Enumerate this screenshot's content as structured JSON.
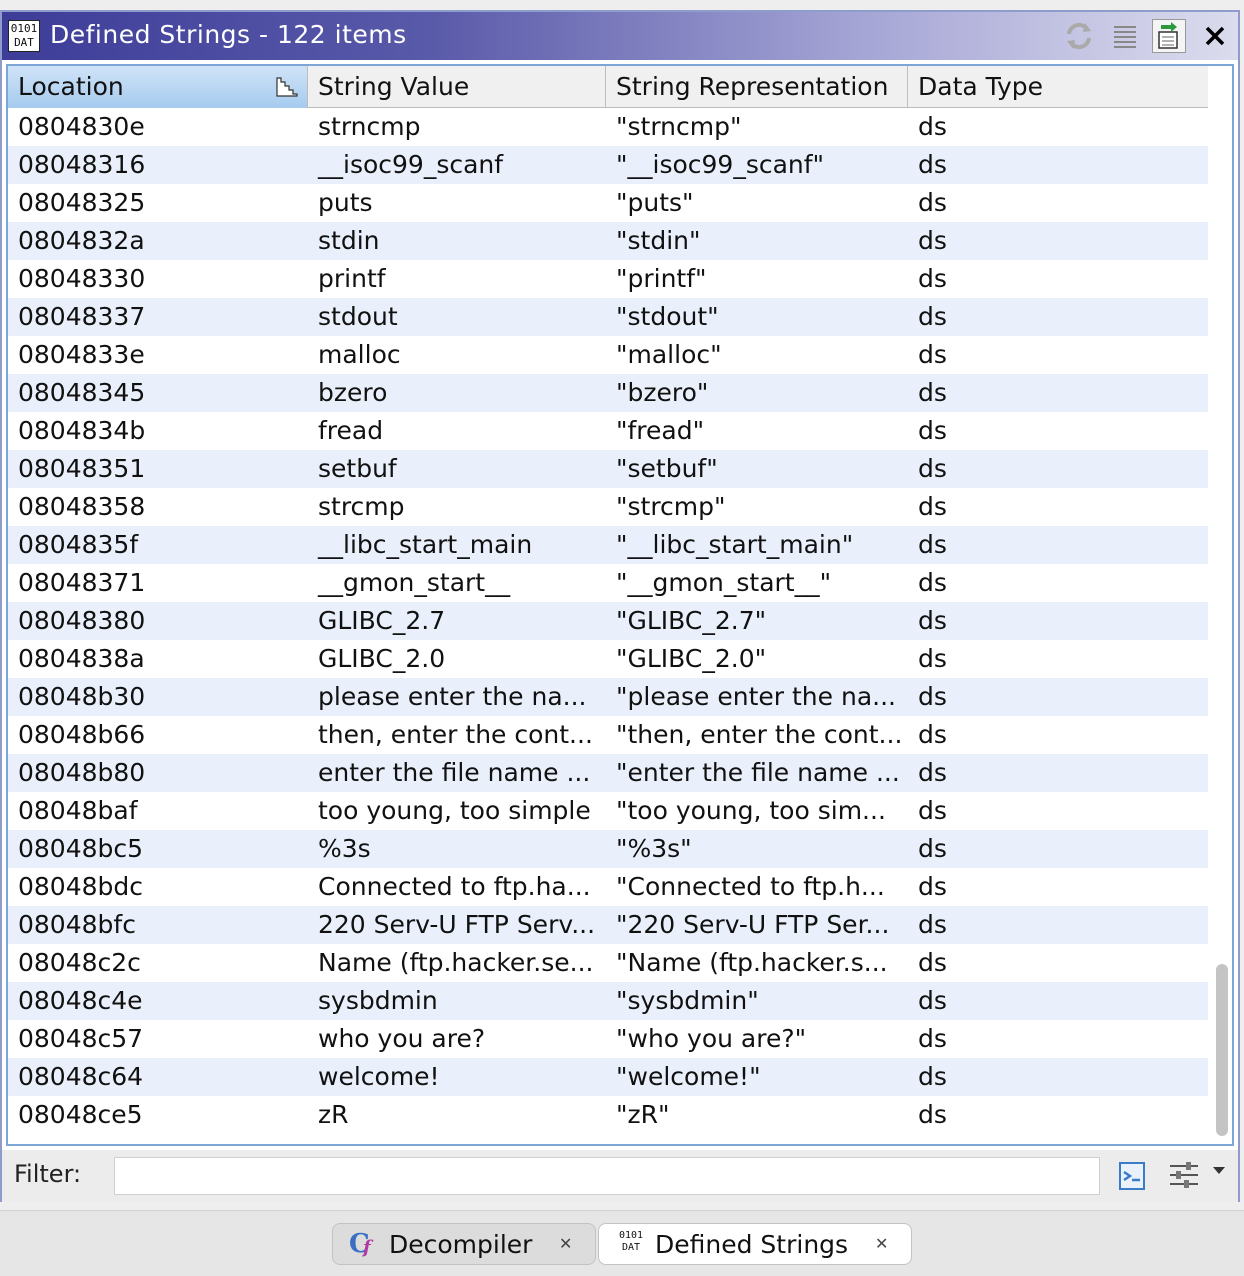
{
  "window": {
    "title": "Defined Strings - 122 items",
    "icon_text_line1": "0101",
    "icon_text_line2": "DAT",
    "toolbar_icons": [
      "refresh-icon",
      "list-icon",
      "navigate-icon",
      "close-icon"
    ]
  },
  "table": {
    "columns": [
      "Location",
      "String Value",
      "String Representation",
      "Data Type"
    ],
    "sorted_column": "Location",
    "rows": [
      {
        "location": "0804830e",
        "value": "strncmp",
        "repr": "\"strncmp\"",
        "type": "ds"
      },
      {
        "location": "08048316",
        "value": "__isoc99_scanf",
        "repr": "\"__isoc99_scanf\"",
        "type": "ds"
      },
      {
        "location": "08048325",
        "value": "puts",
        "repr": "\"puts\"",
        "type": "ds"
      },
      {
        "location": "0804832a",
        "value": "stdin",
        "repr": "\"stdin\"",
        "type": "ds"
      },
      {
        "location": "08048330",
        "value": "printf",
        "repr": "\"printf\"",
        "type": "ds"
      },
      {
        "location": "08048337",
        "value": "stdout",
        "repr": "\"stdout\"",
        "type": "ds"
      },
      {
        "location": "0804833e",
        "value": "malloc",
        "repr": "\"malloc\"",
        "type": "ds"
      },
      {
        "location": "08048345",
        "value": "bzero",
        "repr": "\"bzero\"",
        "type": "ds"
      },
      {
        "location": "0804834b",
        "value": "fread",
        "repr": "\"fread\"",
        "type": "ds"
      },
      {
        "location": "08048351",
        "value": "setbuf",
        "repr": "\"setbuf\"",
        "type": "ds"
      },
      {
        "location": "08048358",
        "value": "strcmp",
        "repr": "\"strcmp\"",
        "type": "ds"
      },
      {
        "location": "0804835f",
        "value": "__libc_start_main",
        "repr": "\"__libc_start_main\"",
        "type": "ds"
      },
      {
        "location": "08048371",
        "value": "__gmon_start__",
        "repr": "\"__gmon_start__\"",
        "type": "ds"
      },
      {
        "location": "08048380",
        "value": "GLIBC_2.7",
        "repr": "\"GLIBC_2.7\"",
        "type": "ds"
      },
      {
        "location": "0804838a",
        "value": "GLIBC_2.0",
        "repr": "\"GLIBC_2.0\"",
        "type": "ds"
      },
      {
        "location": "08048b30",
        "value": "please enter the na...",
        "repr": "\"please enter the na...",
        "type": "ds"
      },
      {
        "location": "08048b66",
        "value": "then, enter the cont...",
        "repr": "\"then, enter the cont...",
        "type": "ds"
      },
      {
        "location": "08048b80",
        "value": "enter the file name ...",
        "repr": "\"enter the file name ...",
        "type": "ds"
      },
      {
        "location": "08048baf",
        "value": "too young, too simple",
        "repr": "\"too young, too sim...",
        "type": "ds"
      },
      {
        "location": "08048bc5",
        "value": "%3s",
        "repr": "\"%3s\"",
        "type": "ds"
      },
      {
        "location": "08048bdc",
        "value": "Connected to ftp.ha...",
        "repr": "\"Connected to ftp.h...",
        "type": "ds"
      },
      {
        "location": "08048bfc",
        "value": "220 Serv-U FTP Serv...",
        "repr": "\"220 Serv-U FTP Ser...",
        "type": "ds"
      },
      {
        "location": "08048c2c",
        "value": "Name (ftp.hacker.se...",
        "repr": "\"Name (ftp.hacker.s...",
        "type": "ds"
      },
      {
        "location": "08048c4e",
        "value": "sysbdmin",
        "repr": "\"sysbdmin\"",
        "type": "ds"
      },
      {
        "location": "08048c57",
        "value": "who you are?",
        "repr": "\"who you are?\"",
        "type": "ds"
      },
      {
        "location": "08048c64",
        "value": "welcome!",
        "repr": "\"welcome!\"",
        "type": "ds"
      },
      {
        "location": "08048ce5",
        "value": "zR",
        "repr": "\"zR\"",
        "type": "ds"
      }
    ]
  },
  "filter": {
    "label": "Filter:",
    "value": ""
  },
  "tabs": [
    {
      "label": "Decompiler",
      "active": false
    },
    {
      "label": "Defined Strings",
      "active": true
    }
  ],
  "colors": {
    "title_gradient_start": "#3d3d99",
    "row_alt": "#eaf0fb",
    "sorted_header": "#a6cbef",
    "border_accent": "#7da6d6"
  }
}
